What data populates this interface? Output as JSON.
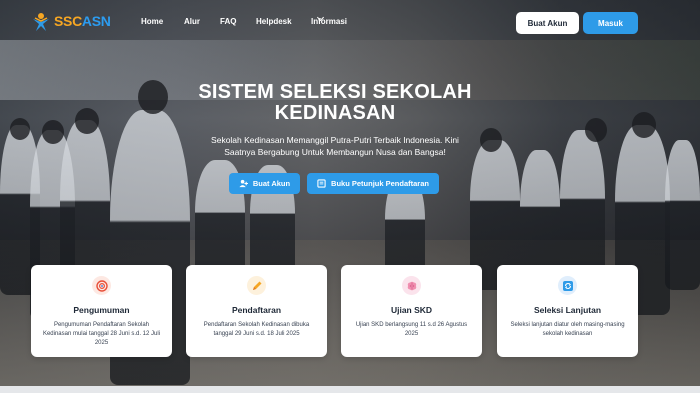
{
  "header": {
    "logo_main": "SSC",
    "logo_accent": "ASN",
    "nav": [
      {
        "label": "Home"
      },
      {
        "label": "Alur"
      },
      {
        "label": "FAQ"
      },
      {
        "label": "Helpdesk"
      },
      {
        "label": "Informasi"
      }
    ],
    "buat_akun": "Buat Akun",
    "masuk": "Masuk"
  },
  "hero": {
    "title_line1": "SISTEM SELEKSI SEKOLAH",
    "title_line2": "KEDINASAN",
    "subtitle_line1": "Sekolah Kedinasan Memanggil Putra-Putri Terbaik Indonesia. Kini",
    "subtitle_line2": "Saatnya Bergabung Untuk Membangun Nusa dan Bangsa!",
    "cta_buat_akun": "Buat Akun",
    "cta_buku": "Buku Petunjuk Pendaftaran"
  },
  "cards": [
    {
      "title": "Pengumuman",
      "desc": "Pengumuman Pendaftaran Sekolah Kedinasan mulai tanggal 28 Juni s.d. 12 Juli 2025",
      "icon": "target-icon",
      "icon_bg": "#fde8e2"
    },
    {
      "title": "Pendaftaran",
      "desc": "Pendaftaran Sekolah Kedinasan dibuka tanggal 29 Juni s.d. 18 Juli 2025",
      "icon": "pencil-icon",
      "icon_bg": "#fdf1dc"
    },
    {
      "title": "Ujian SKD",
      "desc": "Ujian SKD berlangsung 11 s.d 26 Agustus 2025",
      "icon": "brain-icon",
      "icon_bg": "#fbe3ec"
    },
    {
      "title": "Seleksi Lanjutan",
      "desc": "Seleksi lanjutan diatur oleh masing-masing sekolah kedinasan",
      "icon": "refresh-icon",
      "icon_bg": "#e0eefc"
    }
  ],
  "colors": {
    "accent": "#2e9be8",
    "logo_orange": "#f6a623"
  }
}
